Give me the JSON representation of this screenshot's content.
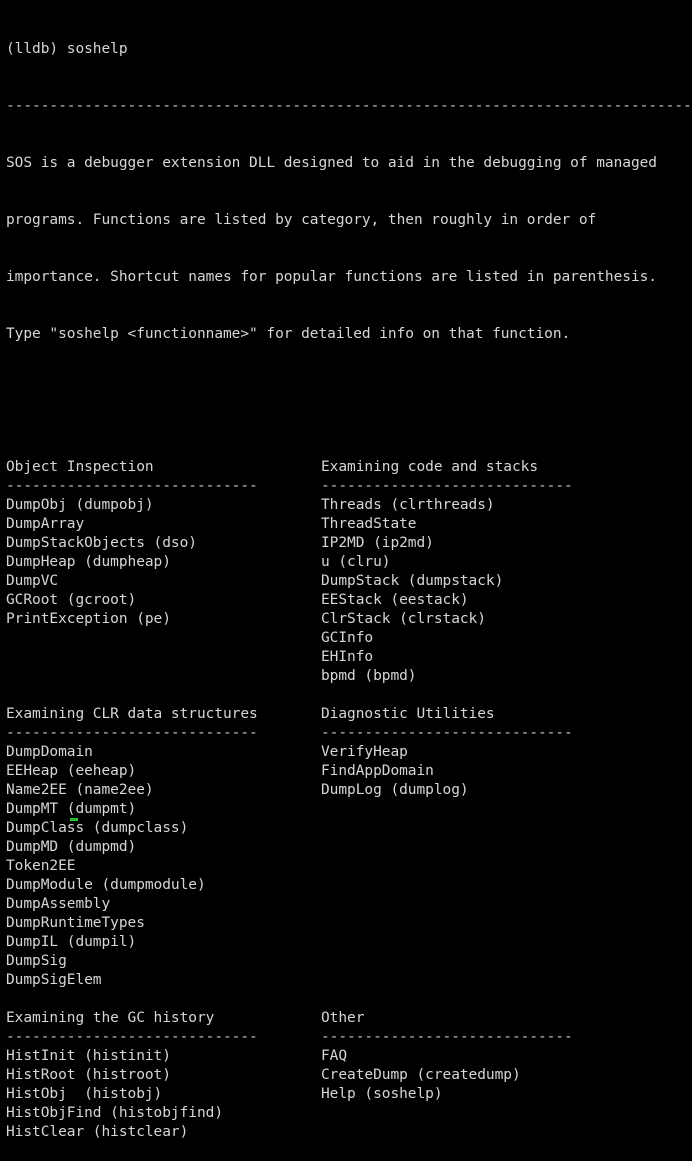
{
  "prompt": "(lldb) soshelp",
  "top_rule": "-------------------------------------------------------------------------------",
  "intro": [
    "SOS is a debugger extension DLL designed to aid in the debugging of managed",
    "programs. Functions are listed by category, then roughly in order of",
    "importance. Shortcut names for popular functions are listed in parenthesis.",
    "Type \"soshelp <functionname>\" for detailed info on that function."
  ],
  "section_rule": "-----------------------------",
  "sections": [
    {
      "left": {
        "title": "Object Inspection",
        "items": [
          "DumpObj (dumpobj)",
          "DumpArray",
          "DumpStackObjects (dso)",
          "DumpHeap (dumpheap)",
          "DumpVC",
          "GCRoot (gcroot)",
          "PrintException (pe)"
        ]
      },
      "right": {
        "title": "Examining code and stacks",
        "items": [
          "Threads (clrthreads)",
          "ThreadState",
          "IP2MD (ip2md)",
          "u (clru)",
          "DumpStack (dumpstack)",
          "EEStack (eestack)",
          "ClrStack (clrstack)",
          "GCInfo",
          "EHInfo",
          "bpmd (bpmd)"
        ]
      }
    },
    {
      "left": {
        "title": "Examining CLR data structures",
        "items": [
          "DumpDomain",
          "EEHeap (eeheap)",
          "Name2EE (name2ee)",
          "DumpMT (dumpmt)",
          "DumpClass (dumpclass)",
          "DumpMD (dumpmd)",
          "Token2EE",
          "DumpModule (dumpmodule)",
          "DumpAssembly",
          "DumpRuntimeTypes",
          "DumpIL (dumpil)",
          "DumpSig",
          "DumpSigElem"
        ]
      },
      "right": {
        "title": "Diagnostic Utilities",
        "items": [
          "VerifyHeap",
          "FindAppDomain",
          "DumpLog (dumplog)"
        ]
      }
    },
    {
      "left": {
        "title": "Examining the GC history",
        "items": [
          "HistInit (histinit)",
          "HistRoot (histroot)",
          "HistObj  (histobj)",
          "HistObjFind (histobjfind)",
          "HistClear (histclear)"
        ]
      },
      "right": {
        "title": "Other",
        "items": [
          "FAQ",
          "CreateDump (createdump)",
          "Help (soshelp)"
        ]
      }
    }
  ],
  "colors": {
    "background": "#000000",
    "text": "#d6d6d6",
    "cursor": "#22c22e"
  }
}
